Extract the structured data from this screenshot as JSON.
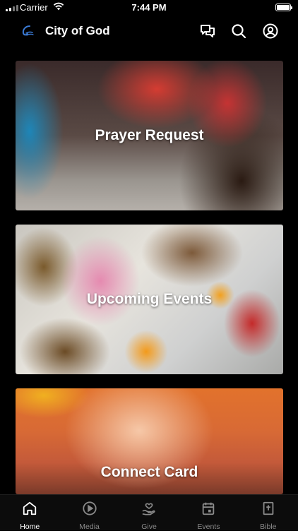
{
  "status_bar": {
    "carrier": "Carrier",
    "time": "7:44 PM",
    "battery_level": 1.0
  },
  "header": {
    "title": "City of God",
    "logo_icon": "city-of-god-logo",
    "actions": [
      {
        "name": "chat-icon"
      },
      {
        "name": "search-icon"
      },
      {
        "name": "profile-icon"
      }
    ]
  },
  "cards": [
    {
      "label": "Prayer Request"
    },
    {
      "label": "Upcoming Events"
    },
    {
      "label": "Connect Card"
    }
  ],
  "tabs": [
    {
      "label": "Home",
      "icon": "home-icon",
      "active": true
    },
    {
      "label": "Media",
      "icon": "play-icon",
      "active": false
    },
    {
      "label": "Give",
      "icon": "give-hand-heart-icon",
      "active": false
    },
    {
      "label": "Events",
      "icon": "calendar-icon",
      "active": false
    },
    {
      "label": "Bible",
      "icon": "bible-icon",
      "active": false
    }
  ],
  "colors": {
    "background": "#000000",
    "active_tab": "#ffffff",
    "inactive_tab": "#8a8a8a",
    "logo_accent": "#3b7bd6"
  }
}
